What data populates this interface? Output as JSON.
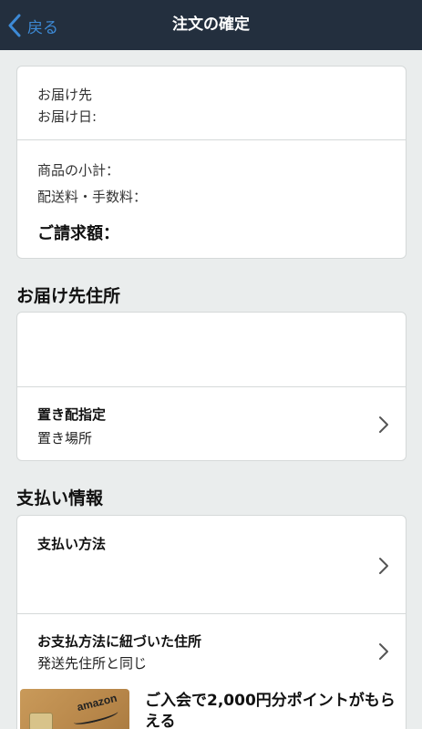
{
  "nav": {
    "back_label": "戻る",
    "title": "注文の確定"
  },
  "summary": {
    "ship_to_label": "お届け先",
    "delivery_date_label": "お届け日:",
    "subtotal_label": "商品の小計：",
    "shipping_fee_label": "配送料・手数料：",
    "total_label": "ご請求額："
  },
  "address_section": {
    "title": "お届け先住所",
    "placement": {
      "title": "置き配指定",
      "subtitle": "置き場所"
    }
  },
  "payment_section": {
    "title": "支払い情報",
    "method_label": "支払い方法",
    "billing": {
      "title": "お支払方法に紐づいた住所",
      "subtitle": "発送先住所と同じ"
    }
  },
  "promo": {
    "card_logo": "amazon",
    "text": "ご入会で2,000円分ポイントがもらえる"
  },
  "colors": {
    "navbar": "#232f3e",
    "back_link": "#3d8ad6",
    "background": "#eaeded"
  }
}
